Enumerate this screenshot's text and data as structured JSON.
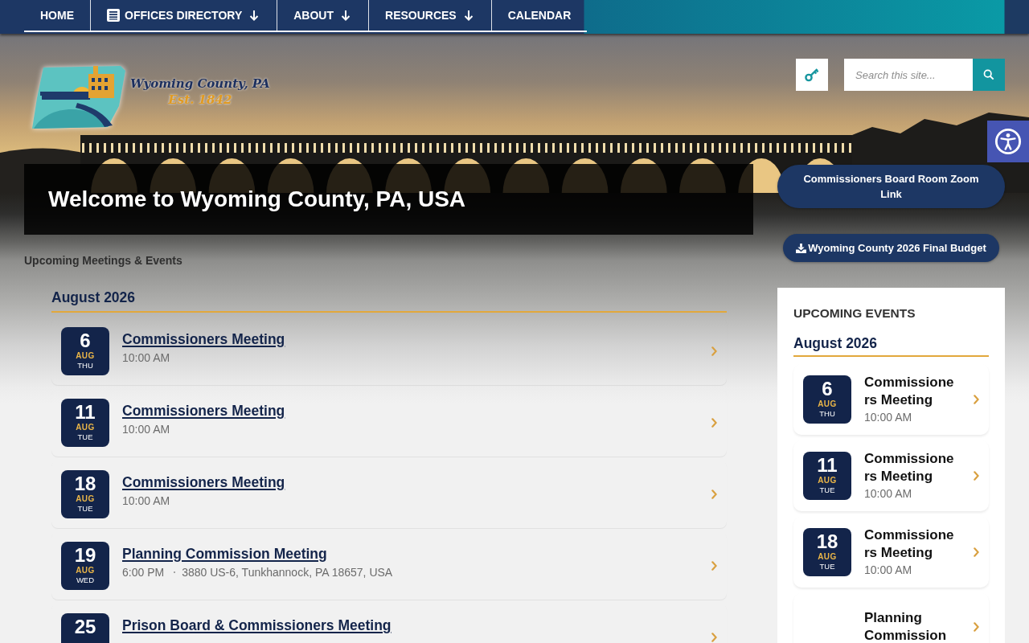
{
  "nav": {
    "items": [
      {
        "label": "HOME",
        "with_icon": false,
        "dropdown": false
      },
      {
        "label": "OFFICES DIRECTORY",
        "with_icon": true,
        "dropdown": true
      },
      {
        "label": "ABOUT",
        "with_icon": false,
        "dropdown": true
      },
      {
        "label": "RESOURCES",
        "with_icon": false,
        "dropdown": true
      },
      {
        "label": "CALENDAR",
        "with_icon": false,
        "dropdown": false
      }
    ]
  },
  "header": {
    "logo": {
      "name": "Wyoming County, PA",
      "established": "Est. 1842"
    },
    "search": {
      "placeholder": "Search this site..."
    }
  },
  "welcome": {
    "title": "Welcome to Wyoming County, PA, USA"
  },
  "quick_links": [
    {
      "label": "Commissioners Board Room Zoom Link",
      "download": false
    },
    {
      "label": "Wyoming County 2026 Final Budget",
      "download": true
    }
  ],
  "meetings": {
    "heading": "Upcoming Meetings & Events",
    "month": "August 2026",
    "events": [
      {
        "day": "6",
        "month": "AUG",
        "weekday": "THU",
        "title": "Commissioners Meeting",
        "time": "10:00 AM"
      },
      {
        "day": "11",
        "month": "AUG",
        "weekday": "TUE",
        "title": "Commissioners Meeting",
        "time": "10:00 AM"
      },
      {
        "day": "18",
        "month": "AUG",
        "weekday": "TUE",
        "title": "Commissioners Meeting",
        "time": "10:00 AM"
      },
      {
        "day": "19",
        "month": "AUG",
        "weekday": "WED",
        "title": "Planning Commission Meeting",
        "time": "6:00 PM",
        "location": "3880 US-6, Tunkhannock, PA 18657, USA"
      },
      {
        "day": "25",
        "title": "Prison Board & Commissioners Meeting"
      }
    ]
  },
  "sidebar": {
    "heading": "UPCOMING EVENTS",
    "month": "August 2026",
    "events": [
      {
        "day": "6",
        "month": "AUG",
        "weekday": "THU",
        "title": "Commissioners Meeting",
        "time": "10:00 AM"
      },
      {
        "day": "11",
        "month": "AUG",
        "weekday": "TUE",
        "title": "Commissioners Meeting",
        "time": "10:00 AM"
      },
      {
        "day": "18",
        "month": "AUG",
        "weekday": "TUE",
        "title": "Commissioners Meeting",
        "time": "10:00 AM"
      },
      {
        "title": "Planning Commission"
      }
    ]
  }
}
